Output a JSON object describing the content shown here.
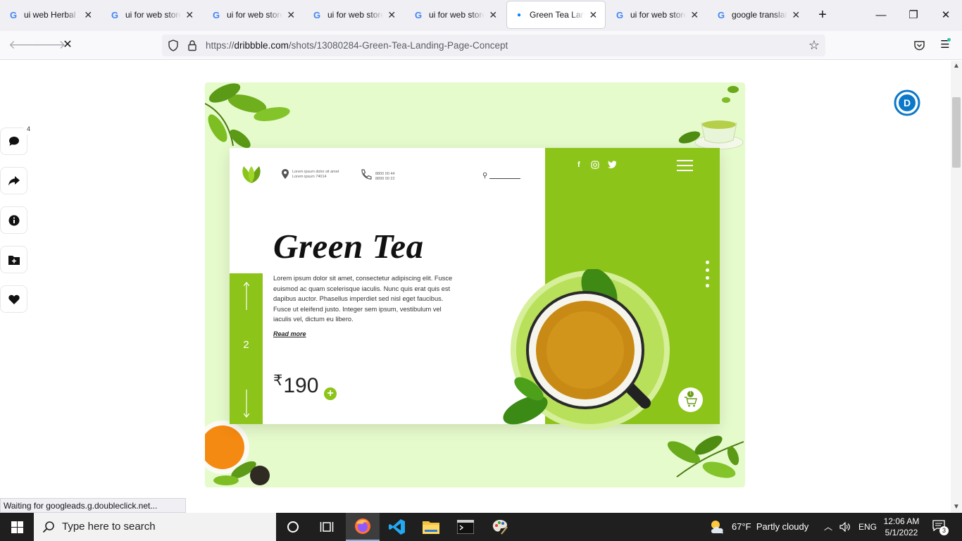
{
  "browser": {
    "tabs": [
      {
        "title": "ui web Herbal Te",
        "favicon": "google-icon",
        "active": false
      },
      {
        "title": "ui for web store",
        "favicon": "google-icon",
        "active": false
      },
      {
        "title": "ui for web store",
        "favicon": "google-icon",
        "active": false
      },
      {
        "title": "ui for web store",
        "favicon": "google-icon",
        "active": false
      },
      {
        "title": "ui for web store",
        "favicon": "google-icon",
        "active": false
      },
      {
        "title": "Green Tea Landi",
        "favicon": "loading-dot-icon",
        "active": true
      },
      {
        "title": "ui for web store",
        "favicon": "google-icon",
        "active": false
      },
      {
        "title": "google translate",
        "favicon": "google-icon",
        "active": false
      }
    ],
    "url_prefix": "https://",
    "url_host": "dribbble.com",
    "url_path": "/shots/13080284-Green-Tea-Landing-Page-Concept",
    "status_text": "Waiting for googleads.g.doubleclick.net..."
  },
  "shot": {
    "location_line1": "Lorem ipsum dolor sit amet",
    "location_line2": "Lorem ipsum 74014",
    "phone_line1": "8800 00 44",
    "phone_line2": "8899 00 22",
    "title": "Green Tea",
    "body": "Lorem ipsum dolor sit amet, consectetur adipiscing elit. Fusce euismod ac quam scelerisque iaculis. Nunc quis erat quis est dapibus auctor. Phasellus imperdiet sed nisl eget faucibus. Fusce ut eleifend justo. Integer sem ipsum, vestibulum vel iaculis vel, dictum eu libero.",
    "read_more": "Read more",
    "currency": "₹",
    "price": "190",
    "plus": "+",
    "slide_number": "2",
    "cart_count": "1",
    "brand_green": "#8cc41a",
    "background_green": "#e6fbcc"
  },
  "side_actions": {
    "comment_count": "4",
    "items": [
      "designer-avatar",
      "comments",
      "share",
      "info",
      "add-to-collection",
      "like"
    ]
  },
  "taskbar": {
    "search_placeholder": "Type here to search",
    "temperature": "67°F",
    "weather": "Partly cloudy",
    "language": "ENG",
    "time": "12:06 AM",
    "date": "5/1/2022",
    "notification_count": "3"
  }
}
